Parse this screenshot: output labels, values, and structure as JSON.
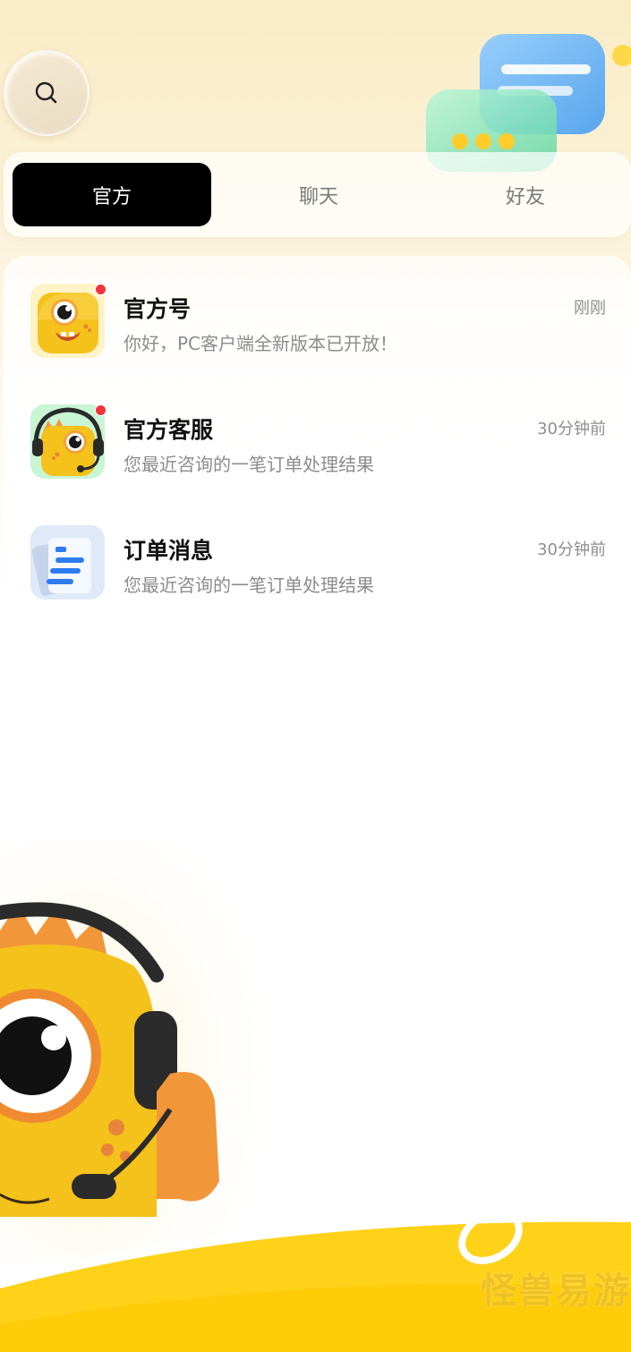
{
  "header": {
    "search_icon": "search-icon"
  },
  "tabs": [
    {
      "label": "官方",
      "active": true
    },
    {
      "label": "聊天",
      "active": false
    },
    {
      "label": "好友",
      "active": false
    }
  ],
  "messages": [
    {
      "title": "官方号",
      "preview": "你好，PC客户端全新版本已开放！",
      "time": "刚刚",
      "unread": true,
      "avatar": "monster-avatar"
    },
    {
      "title": "官方客服",
      "preview": "您最近咨询的一笔订单处理结果",
      "time": "30分钟前",
      "unread": true,
      "avatar": "monster-headset-avatar"
    },
    {
      "title": "订单消息",
      "preview": "您最近咨询的一笔订单处理结果",
      "time": "30分钟前",
      "unread": false,
      "avatar": "document-avatar"
    }
  ],
  "watermark": "怪兽易游",
  "colors": {
    "accent": "#ffd000",
    "active_tab": "#000000",
    "unread_dot": "#f0333a"
  }
}
